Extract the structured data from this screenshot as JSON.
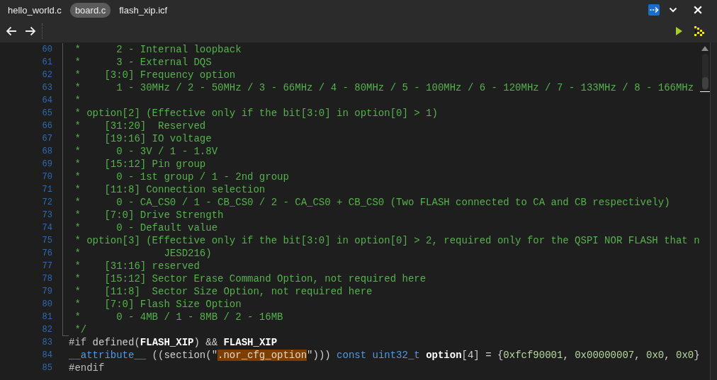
{
  "tabs": [
    {
      "label": "hello_world.c",
      "selected": false
    },
    {
      "label": "board.c",
      "selected": true
    },
    {
      "label": "flash_xip.icf",
      "selected": false
    }
  ],
  "editor": {
    "sections": [
      {
        "kind": "fold",
        "lines": [
          {
            "number": "60",
            "tokens": [
              {
                "kind": "comment",
                "text": " *      2 - Internal loopback"
              }
            ]
          },
          {
            "number": "61",
            "tokens": [
              {
                "kind": "comment",
                "text": " *      3 - External DQS"
              }
            ]
          },
          {
            "number": "62",
            "tokens": [
              {
                "kind": "comment",
                "text": " *    [3:0] Frequency option"
              }
            ]
          },
          {
            "number": "63",
            "tokens": [
              {
                "kind": "comment",
                "text": " *      1 - 30MHz / 2 - 50MHz / 3 - 66MHz / 4 - 80MHz / 5 - 100MHz / 6 - 120MHz / 7 - 133MHz / 8 - 166MHz"
              }
            ]
          },
          {
            "number": "64",
            "tokens": [
              {
                "kind": "comment",
                "text": " *"
              }
            ]
          },
          {
            "number": "65",
            "tokens": [
              {
                "kind": "comment",
                "text": " * option[2] (Effective only if the bit[3:0] in option[0] > 1)"
              }
            ]
          },
          {
            "number": "66",
            "tokens": [
              {
                "kind": "comment",
                "text": " *    [31:20]  Reserved"
              }
            ]
          },
          {
            "number": "67",
            "tokens": [
              {
                "kind": "comment",
                "text": " *    [19:16] IO voltage"
              }
            ]
          },
          {
            "number": "68",
            "tokens": [
              {
                "kind": "comment",
                "text": " *      0 - 3V / 1 - 1.8V"
              }
            ]
          },
          {
            "number": "69",
            "tokens": [
              {
                "kind": "comment",
                "text": " *    [15:12] Pin group"
              }
            ]
          },
          {
            "number": "70",
            "tokens": [
              {
                "kind": "comment",
                "text": " *      0 - 1st group / 1 - 2nd group"
              }
            ]
          },
          {
            "number": "71",
            "tokens": [
              {
                "kind": "comment",
                "text": " *    [11:8] Connection selection"
              }
            ]
          },
          {
            "number": "72",
            "tokens": [
              {
                "kind": "comment",
                "text": " *      0 - CA_CS0 / 1 - CB_CS0 / 2 - CA_CS0 + CB_CS0 (Two FLASH connected to CA and CB respectively)"
              }
            ]
          },
          {
            "number": "73",
            "tokens": [
              {
                "kind": "comment",
                "text": " *    [7:0] Drive Strength"
              }
            ]
          },
          {
            "number": "74",
            "tokens": [
              {
                "kind": "comment",
                "text": " *      0 - Default value"
              }
            ]
          },
          {
            "number": "75",
            "tokens": [
              {
                "kind": "comment",
                "text": " * option[3] (Effective only if the bit[3:0] in option[0] > 2, required only for the QSPI NOR FLASH that n"
              }
            ]
          },
          {
            "number": "76",
            "tokens": [
              {
                "kind": "comment",
                "text": " *              JESD216)"
              }
            ]
          },
          {
            "number": "77",
            "tokens": [
              {
                "kind": "comment",
                "text": " *    [31:16] reserved"
              }
            ]
          },
          {
            "number": "78",
            "tokens": [
              {
                "kind": "comment",
                "text": " *    [15:12] Sector Erase Command Option, not required here"
              }
            ]
          },
          {
            "number": "79",
            "tokens": [
              {
                "kind": "comment",
                "text": " *    [11:8]  Sector Size Option, not required here"
              }
            ]
          },
          {
            "number": "80",
            "tokens": [
              {
                "kind": "comment",
                "text": " *    [7:0] Flash Size Option"
              }
            ]
          },
          {
            "number": "81",
            "tokens": [
              {
                "kind": "comment",
                "text": " *      0 - 4MB / 1 - 8MB / 2 - 16MB"
              }
            ]
          },
          {
            "number": "82",
            "tokens": [
              {
                "kind": "comment",
                "text": " */"
              }
            ]
          }
        ]
      },
      {
        "kind": "plain",
        "lines": [
          {
            "number": "83",
            "tokens": [
              {
                "kind": "directive",
                "text": "#if "
              },
              {
                "kind": "plain",
                "text": "defined("
              },
              {
                "kind": "macro",
                "text": "FLASH_XIP"
              },
              {
                "kind": "plain",
                "text": ") && "
              },
              {
                "kind": "macro",
                "text": "FLASH_XIP"
              }
            ]
          },
          {
            "number": "84",
            "tokens": [
              {
                "kind": "keyword",
                "text": "__attribute__"
              },
              {
                "kind": "plain",
                "text": " ((section(\""
              },
              {
                "kind": "match",
                "text": ".nor_cfg_option"
              },
              {
                "kind": "plain",
                "text": "\"))) "
              },
              {
                "kind": "keyword",
                "text": "const"
              },
              {
                "kind": "keyword",
                "text": " uint32_t"
              },
              {
                "kind": "variable",
                "text": " option"
              },
              {
                "kind": "plain",
                "text": "[4] = {"
              },
              {
                "kind": "number",
                "text": "0xfcf90001"
              },
              {
                "kind": "plain",
                "text": ", "
              },
              {
                "kind": "number",
                "text": "0x00000007"
              },
              {
                "kind": "plain",
                "text": ", "
              },
              {
                "kind": "number",
                "text": "0x0"
              },
              {
                "kind": "plain",
                "text": ", "
              },
              {
                "kind": "number",
                "text": "0x0"
              },
              {
                "kind": "plain",
                "text": "}"
              }
            ]
          },
          {
            "number": "85",
            "tokens": [
              {
                "kind": "directive",
                "text": "#endif"
              }
            ]
          }
        ]
      }
    ]
  }
}
